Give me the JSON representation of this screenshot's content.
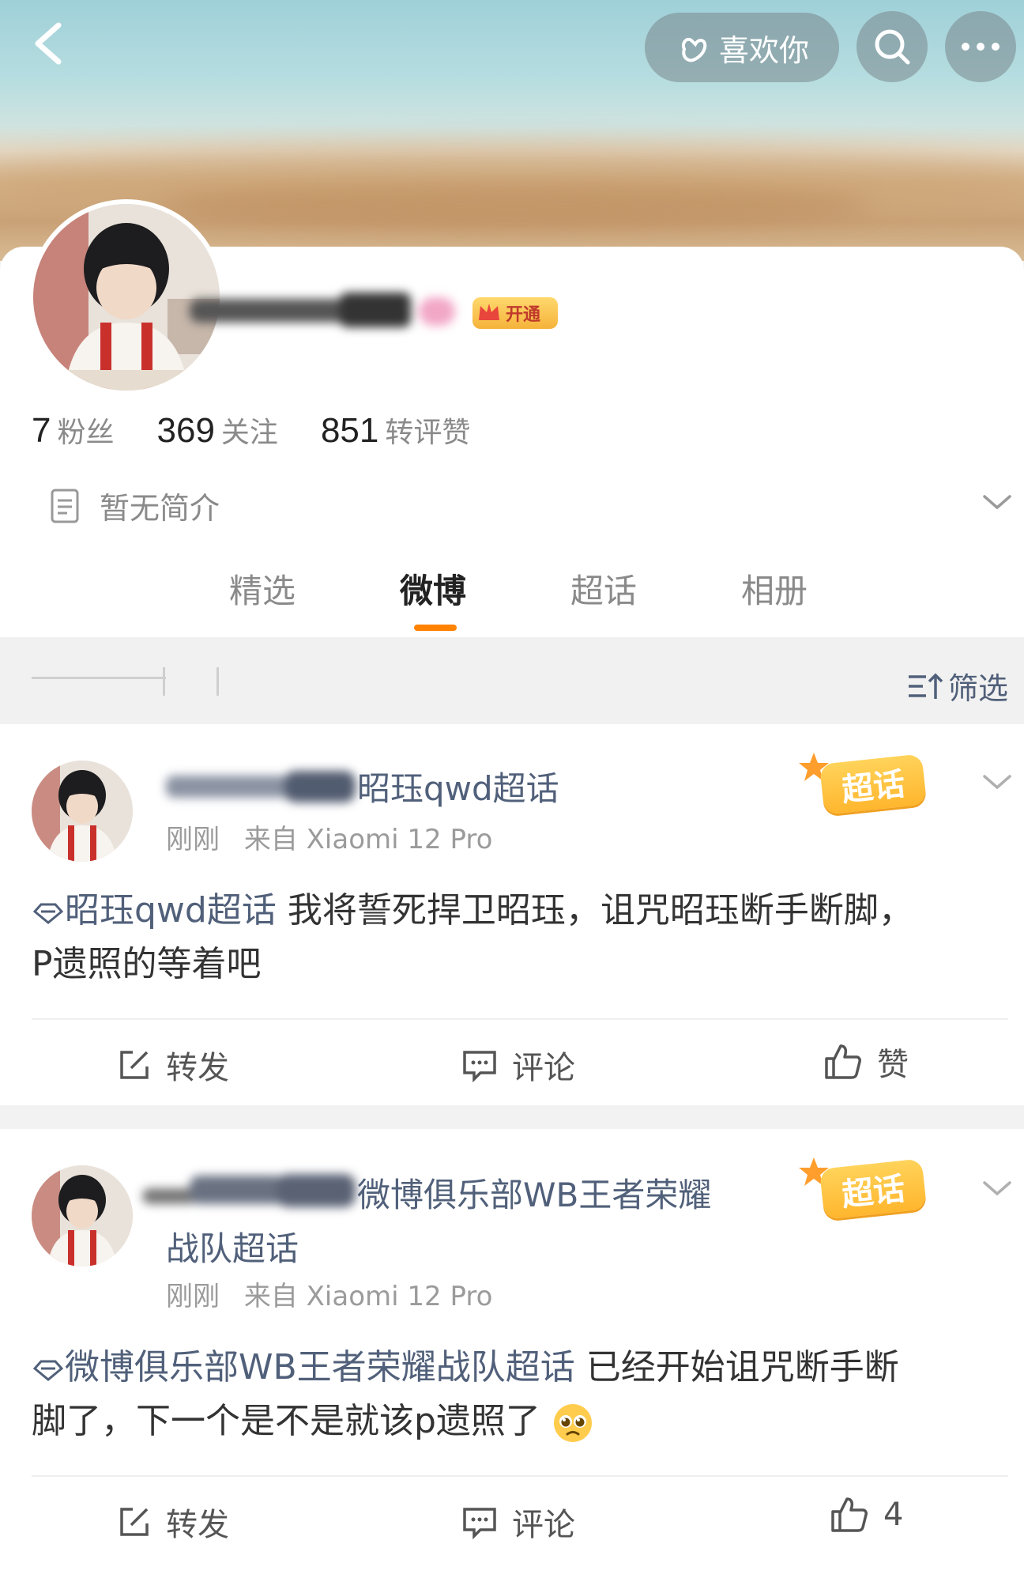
{
  "header": {
    "like_you": "喜欢你"
  },
  "profile": {
    "name_suffix": "",
    "vip_badge": "开通",
    "stats": [
      {
        "num": "7",
        "label": "粉丝"
      },
      {
        "num": "369",
        "label": "关注"
      },
      {
        "num": "851",
        "label": "转评赞"
      }
    ],
    "bio": "暂无简介"
  },
  "tabs": [
    "精选",
    "微博",
    "超话",
    "相册"
  ],
  "filter_label": "筛选",
  "posts": [
    {
      "title_suffix": "昭珏qwd超话",
      "title_line2": "",
      "badge": "超话",
      "time": "刚刚",
      "source": "来自 Xiaomi 12 Pro",
      "topic": "昭珏qwd超话",
      "text_line1_rest": " 我将誓死捍卫昭珏，诅咒昭珏断手断脚，",
      "text_line2": "P遗照的等着吧",
      "forward": "转发",
      "comment": "评论",
      "like": "赞"
    },
    {
      "title_suffix": "微博俱乐部WB王者荣耀",
      "title_line2": "战队超话",
      "badge": "超话",
      "time": "刚刚",
      "source": "来自 Xiaomi 12 Pro",
      "topic": "微博俱乐部WB王者荣耀战队超话",
      "text_line1_rest": " 已经开始诅咒断手断",
      "text_line2": "脚了，下一个是不是就该p遗照了",
      "forward": "转发",
      "comment": "评论",
      "like": "4"
    }
  ]
}
